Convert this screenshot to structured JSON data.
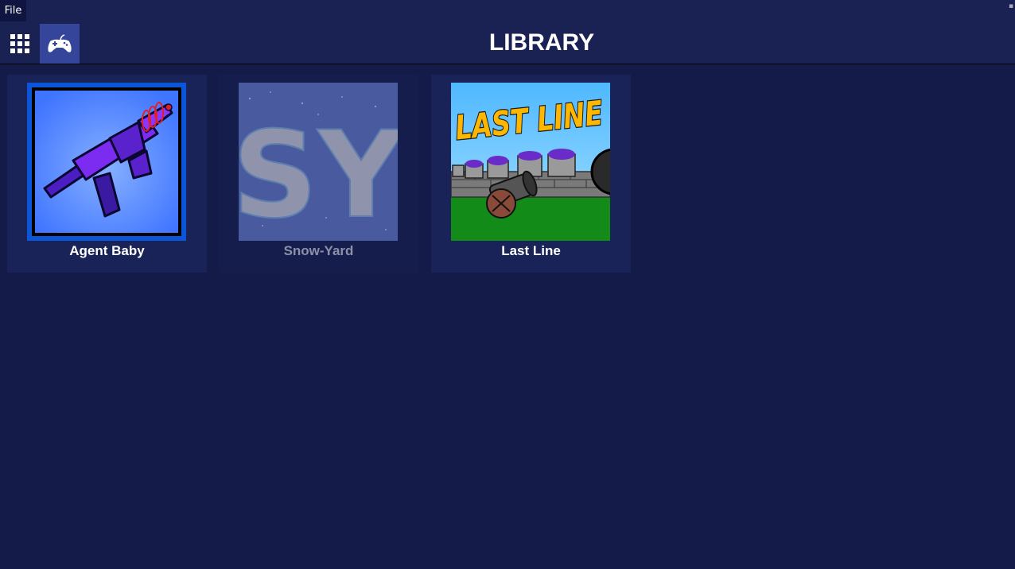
{
  "menubar": {
    "file_label": "File"
  },
  "header": {
    "title": "LIBRARY"
  },
  "games": [
    {
      "title": "Agent Baby"
    },
    {
      "title": "Snow-Yard",
      "art_text": "SY"
    },
    {
      "title": "Last Line",
      "art_text": "LAST LINE"
    }
  ],
  "colors": {
    "background": "#141b49",
    "header": "#1a2153",
    "active_nav": "#34459a",
    "tile": "#1a2357"
  }
}
